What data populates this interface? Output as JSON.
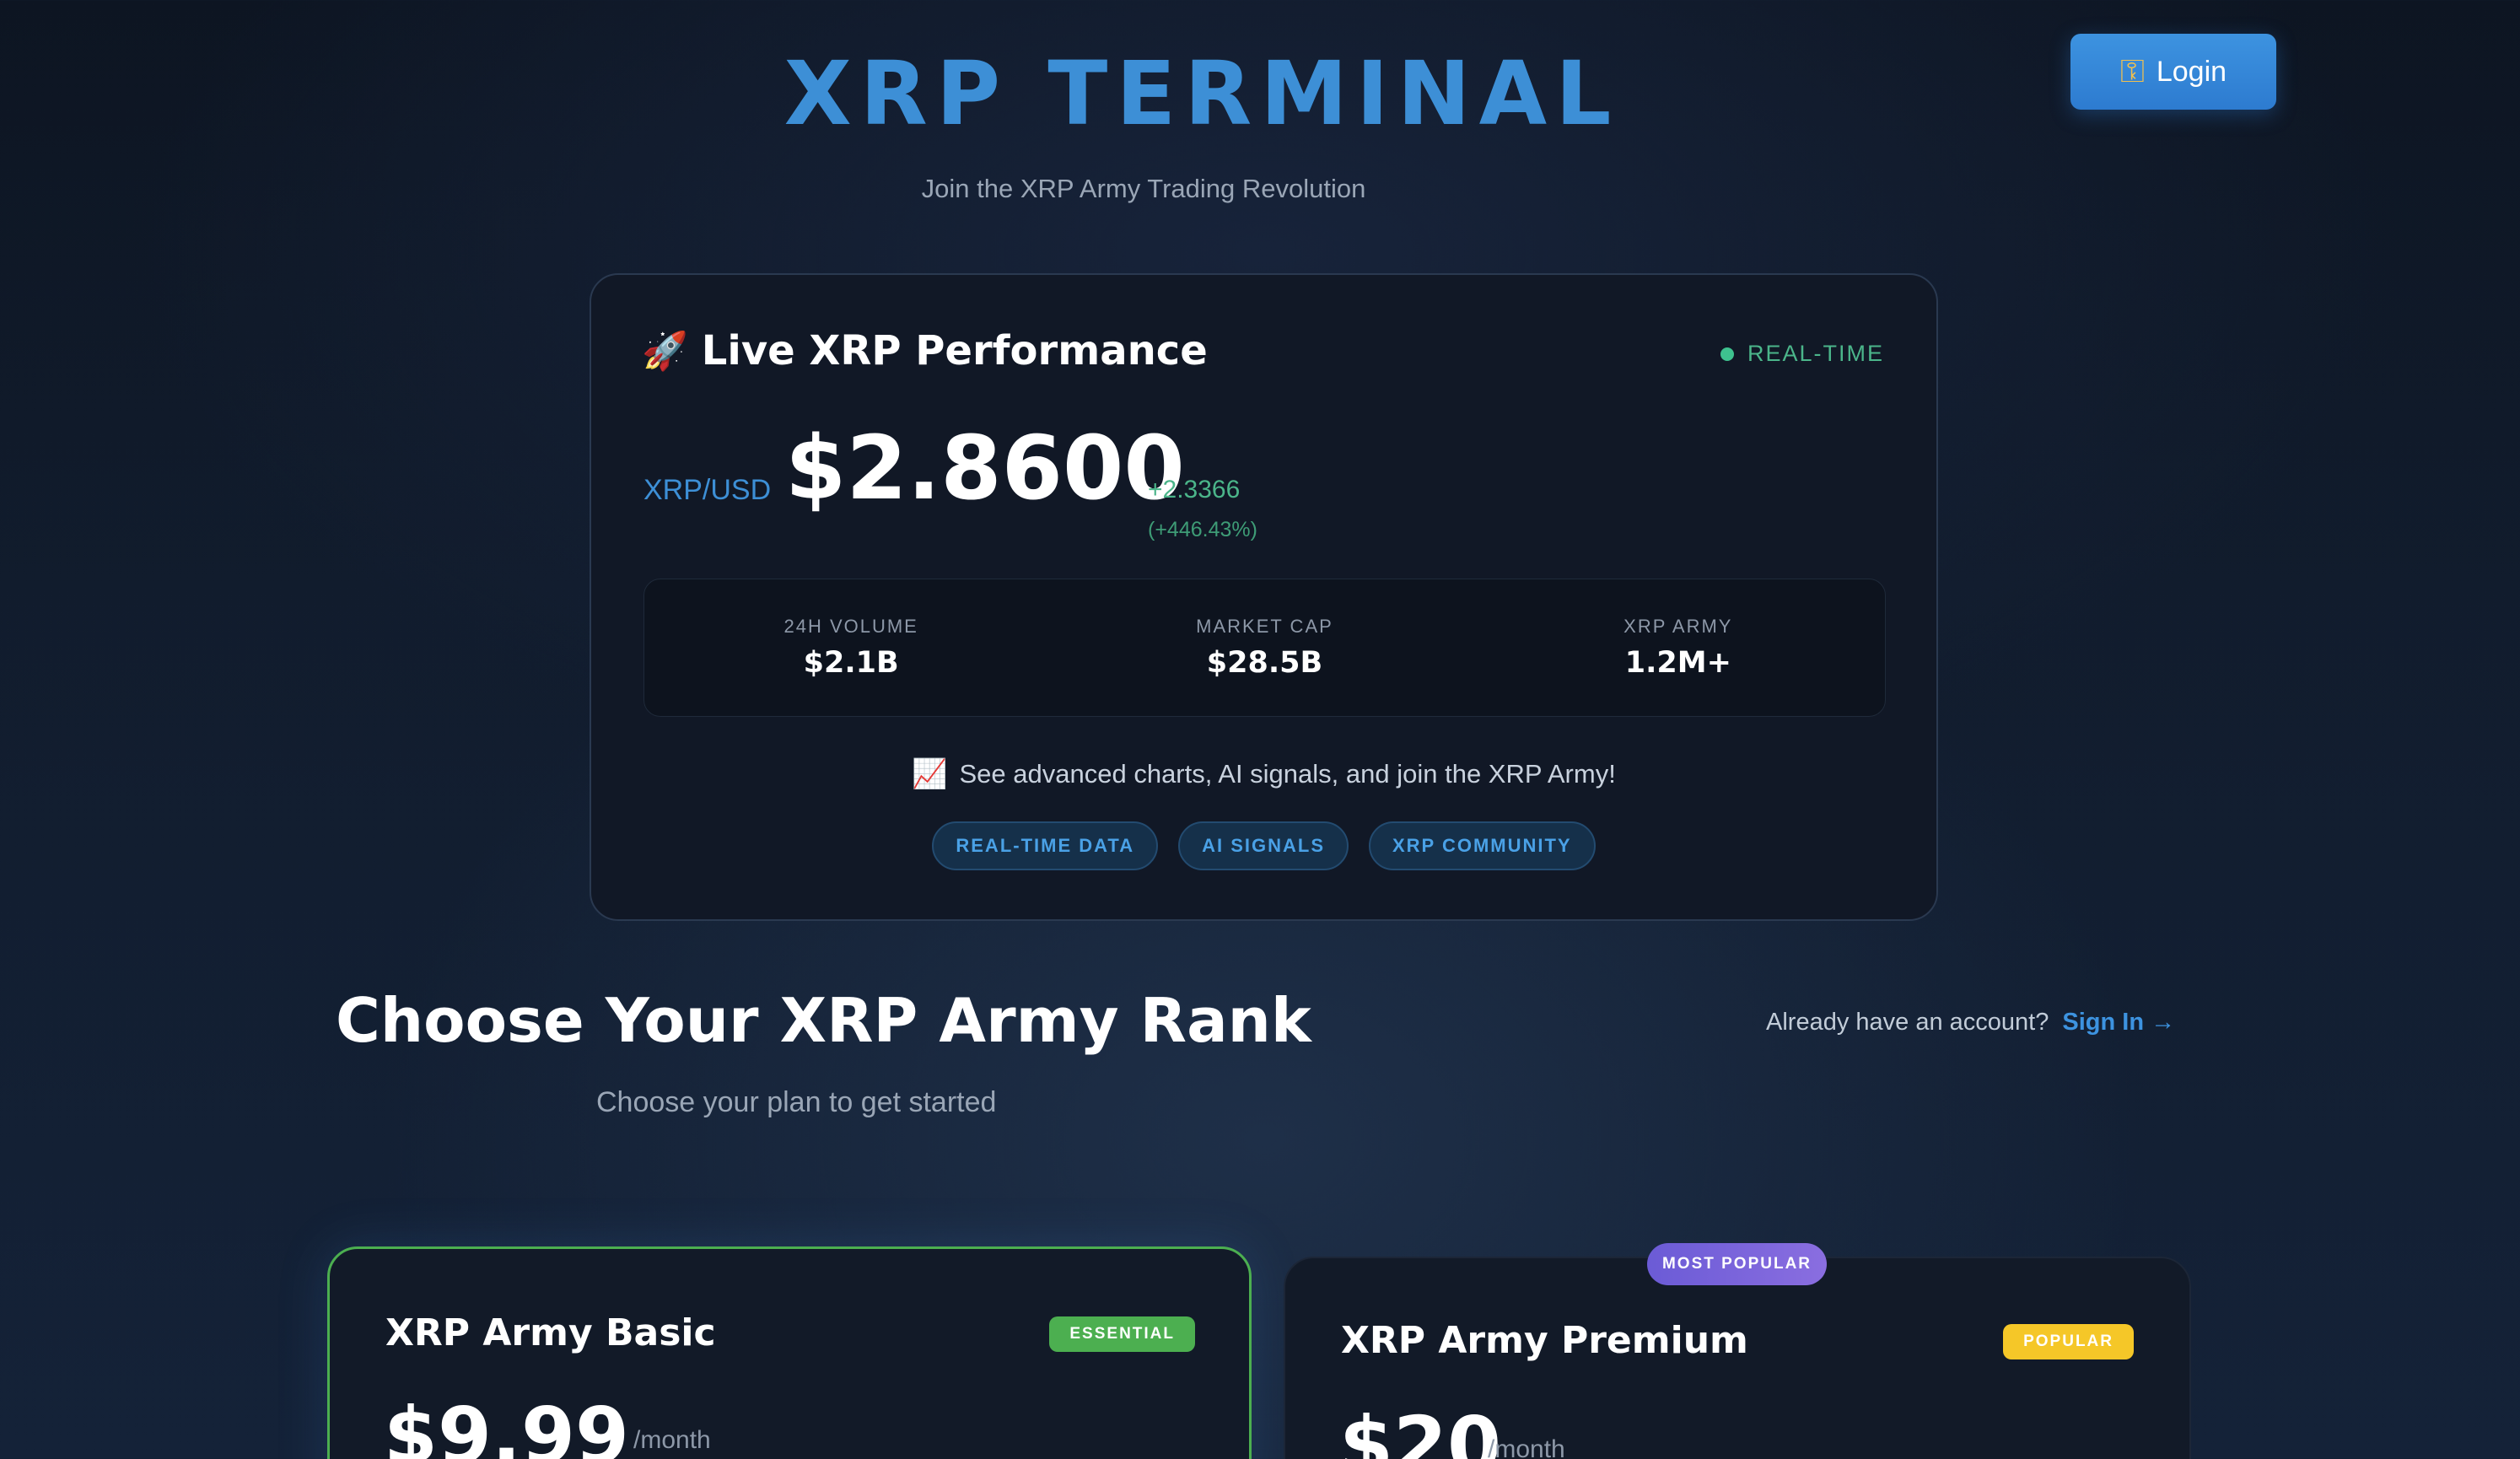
{
  "header": {
    "title": "XRP TERMINAL",
    "subtitle": "Join the XRP Army Trading Revolution",
    "login_icon": "key-icon",
    "login_label": "Login"
  },
  "performance": {
    "icon": "rocket-icon",
    "title": "Live XRP Performance",
    "status": "REAL-TIME",
    "status_color": "#3ec28f",
    "pair": "XRP/USD",
    "price": "$2.8600",
    "change": "+2.3366",
    "change_pct": "(+446.43%)",
    "stats": [
      {
        "label": "24H VOLUME",
        "value": "$2.1B"
      },
      {
        "label": "MARKET CAP",
        "value": "$28.5B"
      },
      {
        "label": "XRP ARMY",
        "value": "1.2M+"
      }
    ],
    "cta_icon": "chart-up-icon",
    "cta_text": "See advanced charts, AI signals, and join the XRP Army!",
    "tags": [
      "REAL-TIME DATA",
      "AI SIGNALS",
      "XRP COMMUNITY"
    ]
  },
  "plans_section": {
    "title": "Choose Your XRP Army Rank",
    "subtitle": "Choose your plan to get started",
    "account_prompt": "Already have an account?",
    "signin_label": "Sign In →"
  },
  "plans": [
    {
      "name": "XRP Army Basic",
      "badge": "ESSENTIAL",
      "badge_color": "#4caf50",
      "price": "$9.99",
      "period": "/month"
    },
    {
      "name": "XRP Army Premium",
      "badge": "POPULAR",
      "badge_color": "#f5c728",
      "price": "$20",
      "period": "/month",
      "ribbon": "MOST POPULAR"
    }
  ],
  "colors": {
    "accent": "#3d8fd6",
    "positive": "#4bb58a"
  }
}
